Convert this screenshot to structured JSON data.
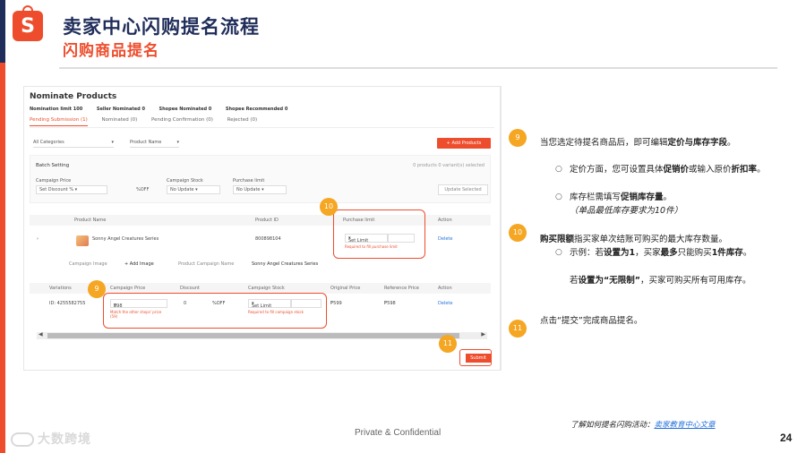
{
  "header": {
    "logo_letter": "S",
    "title": "卖家中心闪购提名流程",
    "subtitle": "闪购商品提名"
  },
  "screenshot": {
    "heading": "Nominate Products",
    "stats": [
      "Nomination limit 100",
      "Seller Nominated 0",
      "Shopee Nominated 0",
      "Shopee Recommended 0"
    ],
    "tabs": [
      "Pending Submission (1)",
      "Nominated (0)",
      "Pending Confirmation (0)",
      "Rejected (0)"
    ],
    "category_filter": "All Categories",
    "name_filter": "Product Name",
    "add_products": "+ Add Products",
    "batch": {
      "title": "Batch Setting",
      "selection": "0 products 0 variant(s) selected",
      "campaign_price_label": "Campaign Price",
      "campaign_price_value": "Set Discount %",
      "off_suffix": "%OFF",
      "campaign_stock_label": "Campaign Stock",
      "campaign_stock_value": "No Update",
      "purchase_limit_label": "Purchase limit",
      "purchase_limit_value": "No Update",
      "update_button": "Update Selected"
    },
    "product_table": {
      "headers": [
        "Product Name",
        "Product ID",
        "Purchase limit",
        "Action"
      ],
      "product_name": "Sonny Angel Creatures Series",
      "product_id": "800898104",
      "limit_select": "Set Limit",
      "limit_warning": "Required to fill purchase limit",
      "action": "Delete",
      "image_label": "Campaign Image",
      "add_image": "+ Add Image",
      "campaign_name_label": "Product Campaign Name",
      "campaign_name": "Sonny Angel Creatures Series"
    },
    "variation_table": {
      "headers": [
        "Variations",
        "Campaign Price",
        "Discount",
        "Campaign Stock",
        "Original Price",
        "Reference Price",
        "Action"
      ],
      "variation_id": "ID: 4255582755",
      "currency": "₱",
      "price": "598",
      "price_warning": "Match the other shops' price (59)",
      "discount": "0",
      "off": "%OFF",
      "stock_select": "Set Limit",
      "stock_warning": "Required to fill campaign stock",
      "original_price": "₱599",
      "reference_price": "₱598",
      "action": "Delete"
    },
    "submit": "Submit"
  },
  "badges": {
    "b9a": "9",
    "b9b": "9",
    "b10": "10",
    "b11": "11",
    "r9": "9",
    "r10": "10",
    "r11": "11"
  },
  "steps": {
    "s9_pre": "当您选定待提名商品后，即可编辑",
    "s9_bold": "定价与库存字段",
    "s9_post": "。",
    "s9_b1_pre": "定价方面，您可设置具体",
    "s9_b1_bold1": "促销价",
    "s9_b1_mid": "或输入原价",
    "s9_b1_bold2": "折扣率",
    "s9_b1_post": "。",
    "s9_b2_pre": "库存栏需填写",
    "s9_b2_bold": "促销库存量",
    "s9_b2_post": "。",
    "s9_b2_note": "（单品最低库存要求为10件）",
    "s10_bold": "购买限额",
    "s10_post": "指买家单次结账可购买的最大库存数量。",
    "s10_b1_pre": "示例：若",
    "s10_b1_bold1": "设置为1",
    "s10_b1_mid": "，买家",
    "s10_b1_bold2": "最多",
    "s10_b1_mid2": "只能购买",
    "s10_b1_bold3": "1件库存",
    "s10_b1_post": "。",
    "s10_b2_pre": "若",
    "s10_b2_bold": "设置为“无限制”",
    "s10_b2_post": "，买家可购买所有可用库存。",
    "s11": "点击“提交”完成商品提名。"
  },
  "footer": {
    "confidential": "Private & Confidential",
    "learn_more": "了解如何提名闪购活动：",
    "link_text": "卖家教育中心文章",
    "page_number": "24",
    "watermark": "大数跨境"
  },
  "colors": {
    "brand": "#ee4d2d",
    "navy": "#1f2d5a",
    "badge": "#f5a623"
  }
}
